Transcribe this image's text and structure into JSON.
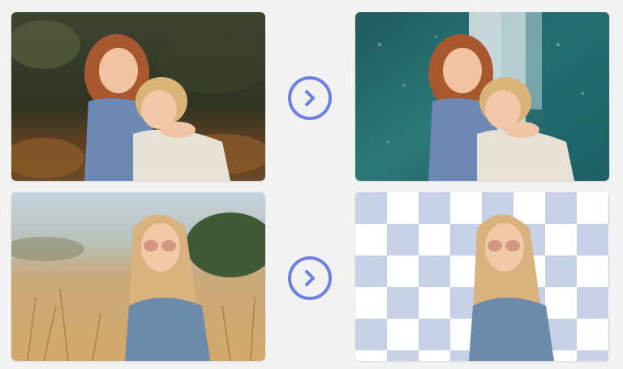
{
  "examples": [
    {
      "before": {
        "description_icon": "photo-girls-hugging-outdoors"
      },
      "after": {
        "description_icon": "photo-girls-hugging-new-background"
      }
    },
    {
      "before": {
        "description_icon": "photo-woman-in-wheat-field"
      },
      "after": {
        "description_icon": "photo-woman-transparent-background"
      }
    }
  ],
  "colors": {
    "page_bg": "#f2f2f3",
    "accent": "#6f81e0",
    "checker_light": "#ffffff",
    "checker_dark": "#c6d1e8"
  },
  "icons": {
    "arrow": "chevron-right-icon"
  }
}
